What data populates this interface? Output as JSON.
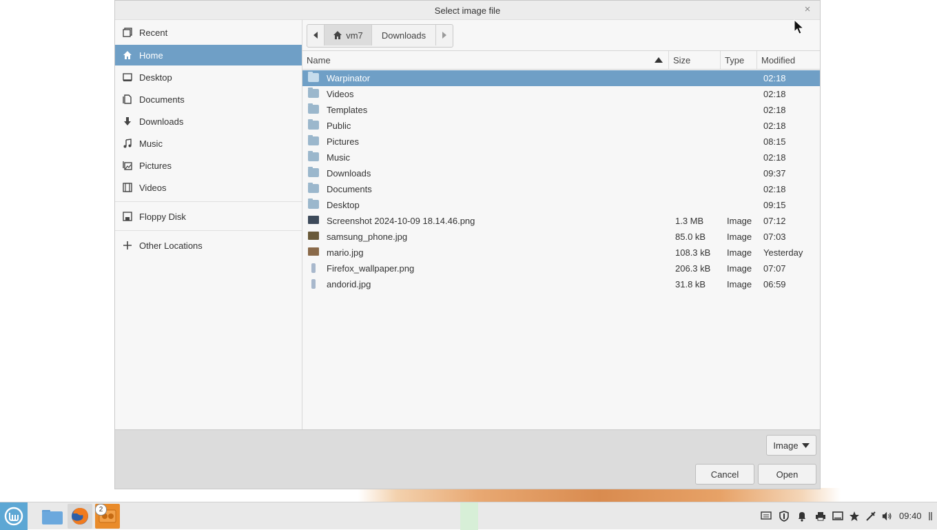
{
  "dialog": {
    "title": "Select image file",
    "close_glyph": "×"
  },
  "sidebar": {
    "items": [
      {
        "label": "Recent",
        "icon": "recent-icon"
      },
      {
        "label": "Home",
        "icon": "home-icon",
        "active": true
      },
      {
        "label": "Desktop",
        "icon": "desktop-icon"
      },
      {
        "label": "Documents",
        "icon": "documents-icon"
      },
      {
        "label": "Downloads",
        "icon": "downloads-icon"
      },
      {
        "label": "Music",
        "icon": "music-icon"
      },
      {
        "label": "Pictures",
        "icon": "pictures-icon"
      },
      {
        "label": "Videos",
        "icon": "videos-icon"
      },
      {
        "label": "Floppy Disk",
        "icon": "floppy-icon"
      },
      {
        "label": "Other Locations",
        "icon": "plus-icon"
      }
    ]
  },
  "pathbar": {
    "home_label": "vm7",
    "next_label": "Downloads"
  },
  "columns": {
    "name": "Name",
    "size": "Size",
    "type": "Type",
    "modified": "Modified"
  },
  "files": [
    {
      "name": "Warpinator",
      "size": "",
      "type": "",
      "modified": "02:18",
      "kind": "folder",
      "selected": true
    },
    {
      "name": "Videos",
      "size": "",
      "type": "",
      "modified": "02:18",
      "kind": "folder"
    },
    {
      "name": "Templates",
      "size": "",
      "type": "",
      "modified": "02:18",
      "kind": "folder"
    },
    {
      "name": "Public",
      "size": "",
      "type": "",
      "modified": "02:18",
      "kind": "folder"
    },
    {
      "name": "Pictures",
      "size": "",
      "type": "",
      "modified": "08:15",
      "kind": "folder"
    },
    {
      "name": "Music",
      "size": "",
      "type": "",
      "modified": "02:18",
      "kind": "folder"
    },
    {
      "name": "Downloads",
      "size": "",
      "type": "",
      "modified": "09:37",
      "kind": "folder"
    },
    {
      "name": "Documents",
      "size": "",
      "type": "",
      "modified": "02:18",
      "kind": "folder"
    },
    {
      "name": "Desktop",
      "size": "",
      "type": "",
      "modified": "09:15",
      "kind": "folder"
    },
    {
      "name": "Screenshot 2024-10-09 18.14.46.png",
      "size": "1.3 MB",
      "type": "Image",
      "modified": "07:12",
      "kind": "image"
    },
    {
      "name": "samsung_phone.jpg",
      "size": "85.0 kB",
      "type": "Image",
      "modified": "07:03",
      "kind": "image"
    },
    {
      "name": "mario.jpg",
      "size": "108.3 kB",
      "type": "Image",
      "modified": "Yesterday",
      "kind": "image"
    },
    {
      "name": "Firefox_wallpaper.png",
      "size": "206.3 kB",
      "type": "Image",
      "modified": "07:07",
      "kind": "image-narrow"
    },
    {
      "name": "andorid.jpg",
      "size": "31.8 kB",
      "type": "Image",
      "modified": "06:59",
      "kind": "image-narrow"
    }
  ],
  "footer": {
    "filter_label": "Image",
    "cancel_label": "Cancel",
    "open_label": "Open"
  },
  "taskbar": {
    "badge": "2",
    "clock": "09:40"
  },
  "colors": {
    "selection": "#6f9fc6",
    "mint_accent": "#5da7d4"
  }
}
